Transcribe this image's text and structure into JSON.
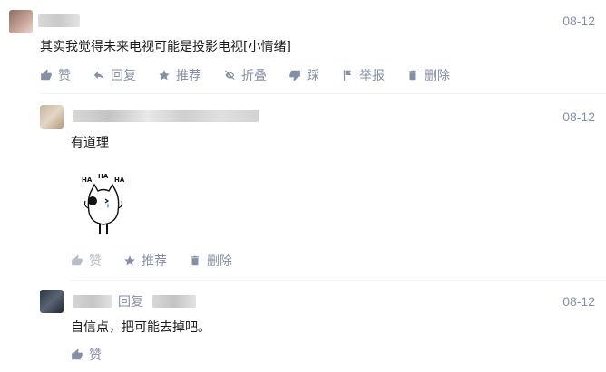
{
  "comments": [
    {
      "date": "08-12",
      "text": "其实我觉得未来电视可能是投影电视[小情绪]",
      "actions": [
        {
          "label": "赞",
          "icon": "thumbs-up-icon"
        },
        {
          "label": "回复",
          "icon": "reply-icon"
        },
        {
          "label": "推荐",
          "icon": "star-icon"
        },
        {
          "label": "折叠",
          "icon": "eye-off-icon"
        },
        {
          "label": "踩",
          "icon": "thumbs-down-icon"
        },
        {
          "label": "举报",
          "icon": "flag-icon"
        },
        {
          "label": "删除",
          "icon": "trash-icon"
        }
      ]
    },
    {
      "date": "08-12",
      "text": "有道理",
      "sticker_text": [
        "HA",
        "HA",
        "HA"
      ],
      "actions": [
        {
          "label": "赞",
          "icon": "thumbs-up-icon"
        },
        {
          "label": "推荐",
          "icon": "star-icon"
        },
        {
          "label": "删除",
          "icon": "trash-icon"
        }
      ]
    },
    {
      "date": "08-12",
      "reply_label": "回复",
      "text": "自信点，把可能去掉吧。",
      "actions": [
        {
          "label": "赞",
          "icon": "thumbs-up-icon"
        }
      ]
    }
  ],
  "colors": {
    "meta": "#8590a6",
    "text": "#1a1a1a",
    "divider": "#f0f2f7"
  }
}
